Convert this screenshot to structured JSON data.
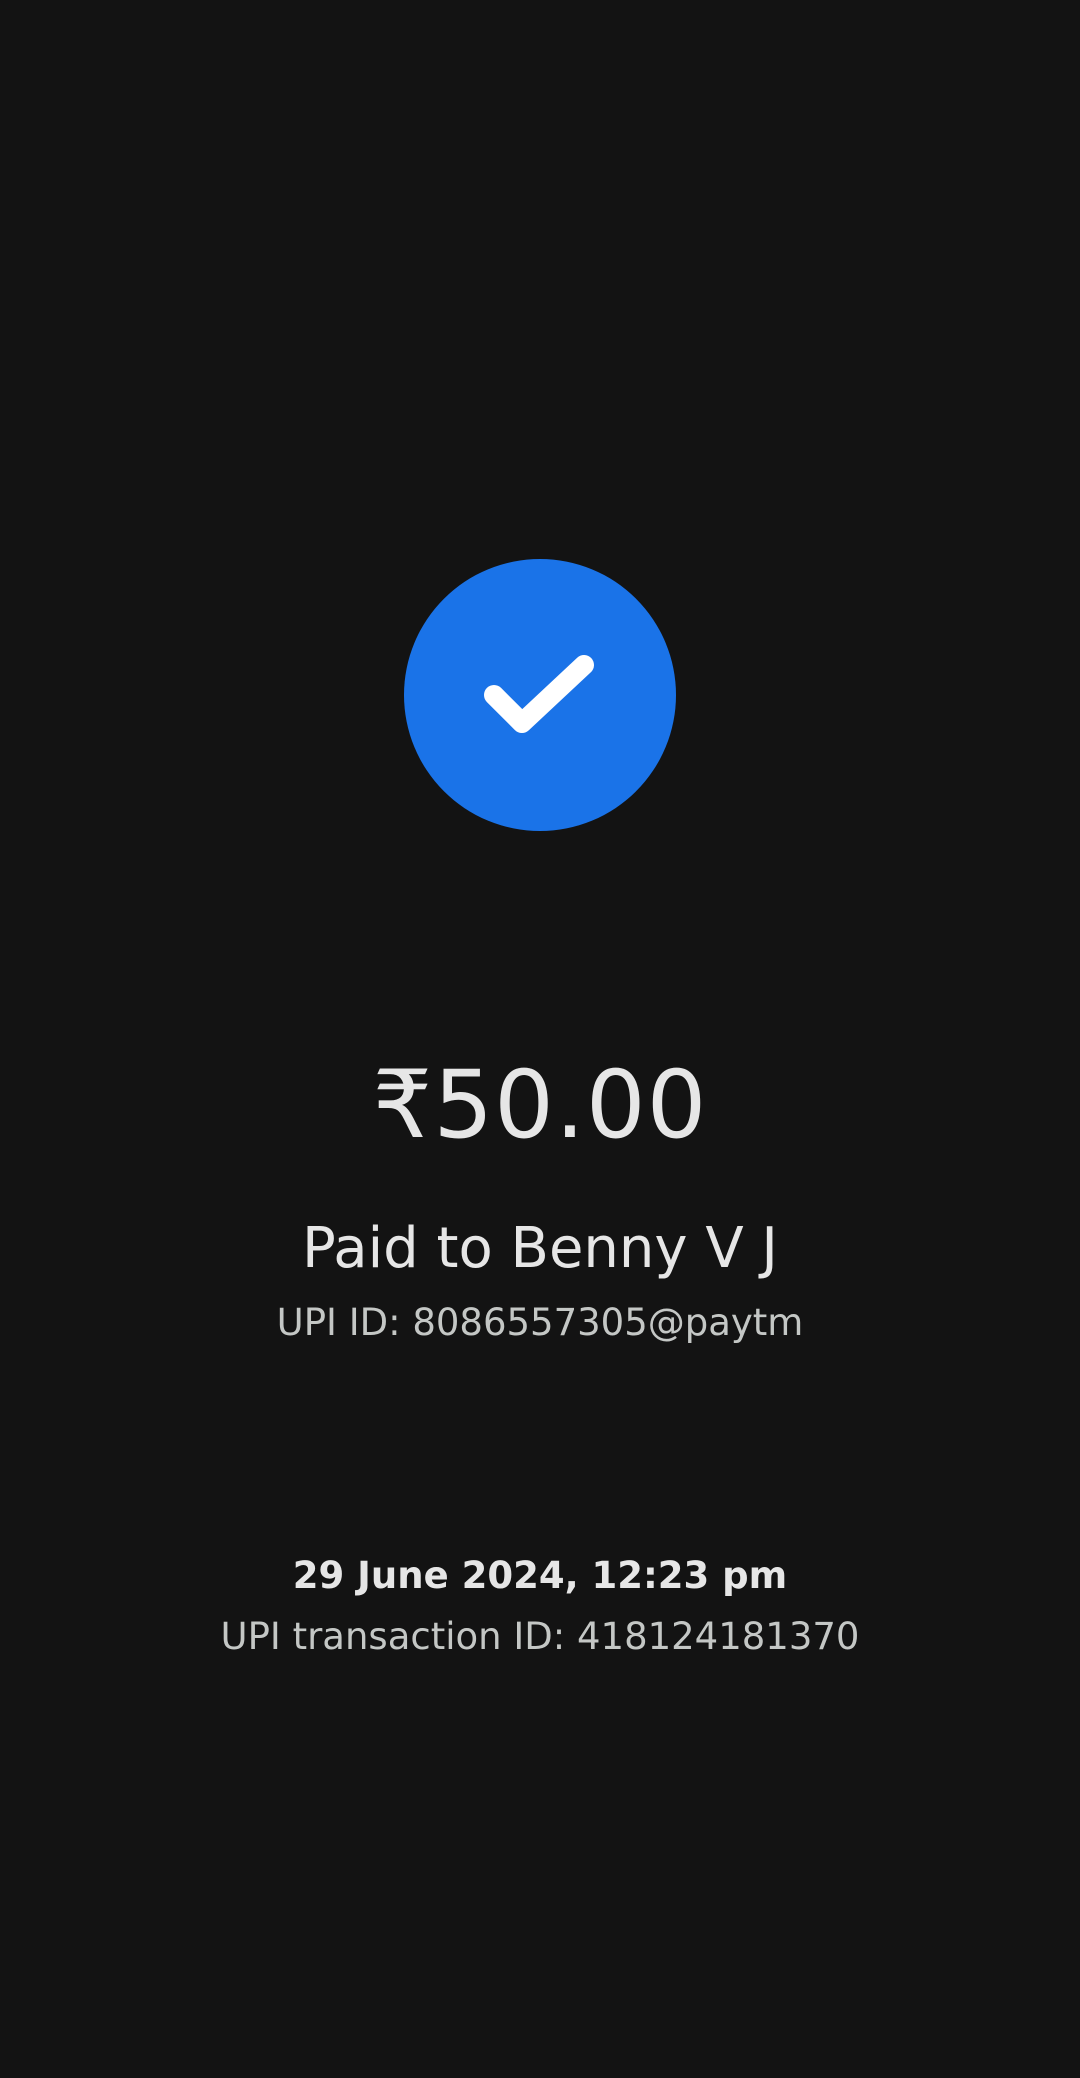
{
  "status": {
    "icon": "check-icon",
    "circle_color": "#1a73e8",
    "check_color": "#ffffff"
  },
  "payment": {
    "amount": "₹50.00",
    "paid_to": "Paid to Benny V J",
    "upi_id": "UPI ID: 8086557305@paytm"
  },
  "transaction": {
    "datetime": "29 June 2024, 12:23 pm",
    "upi_transaction_id": "UPI transaction ID: 418124181370"
  },
  "theme": {
    "background": "#131313"
  }
}
